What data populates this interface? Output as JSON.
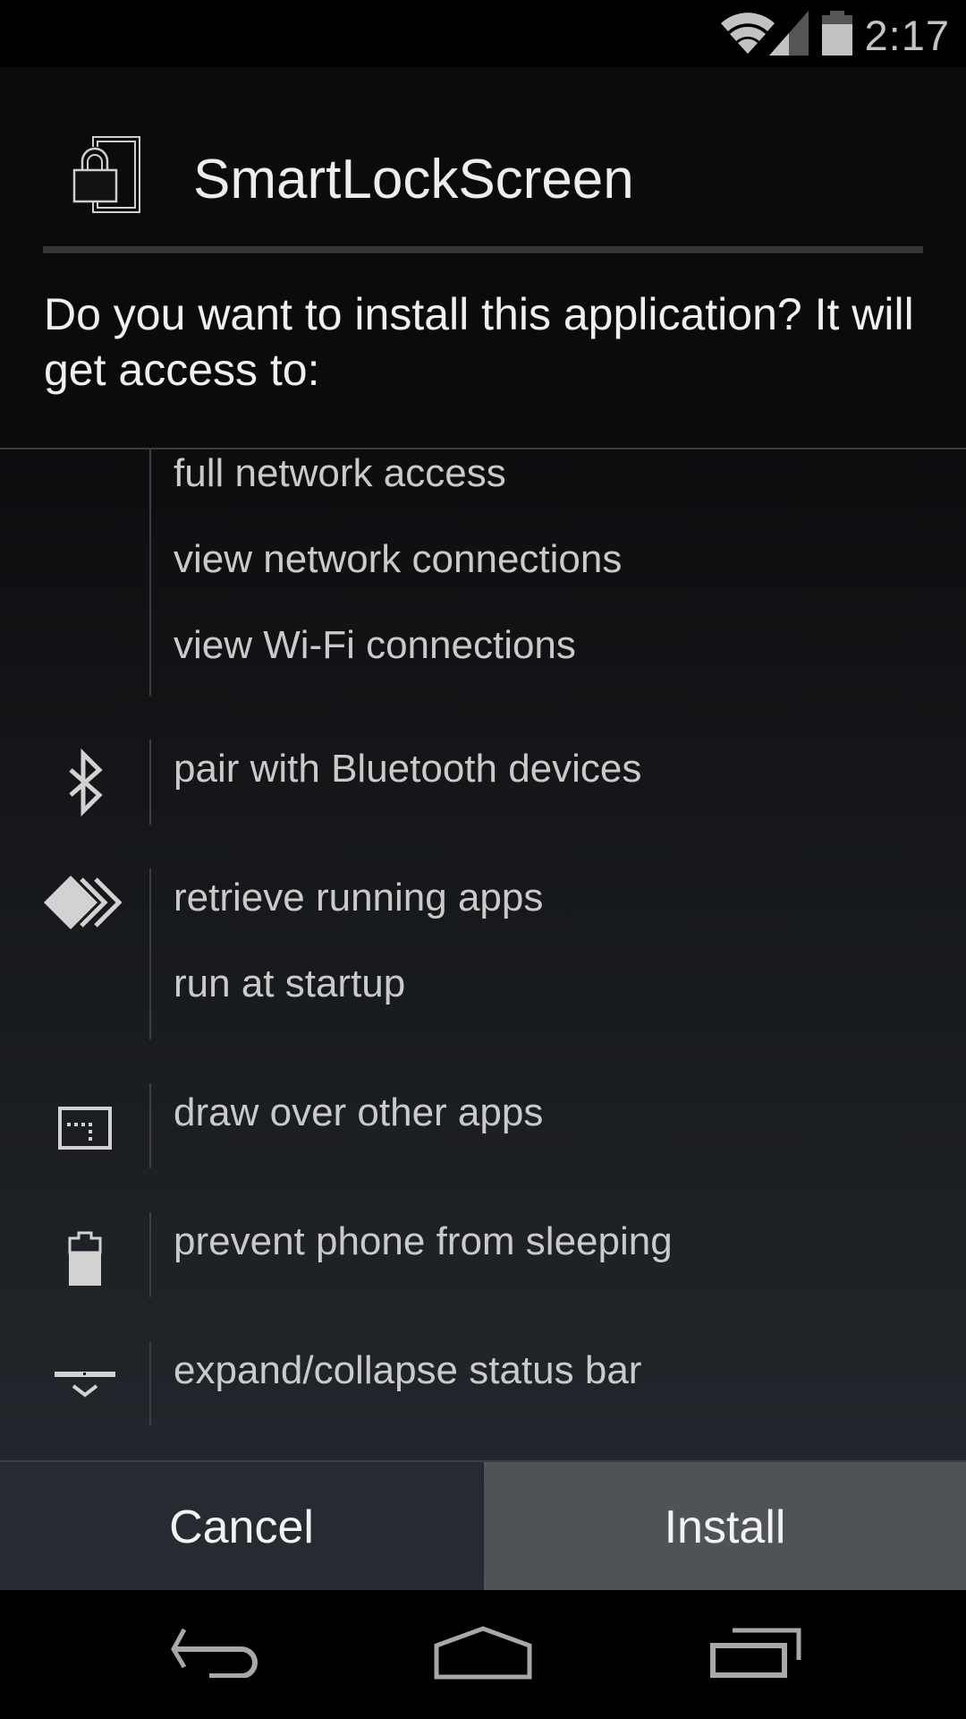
{
  "status_bar": {
    "time": "2:17",
    "icons": [
      "wifi-icon",
      "cell-signal-icon",
      "battery-icon"
    ]
  },
  "dialog": {
    "app_name": "SmartLockScreen",
    "app_icon": "lock-screen-app-icon",
    "question": "Do you want to install this application? It will get access to:",
    "permission_groups": [
      {
        "icon": "network-icon",
        "permissions": [
          "full network access",
          "view network connections",
          "view Wi-Fi connections"
        ]
      },
      {
        "icon": "bluetooth-icon",
        "permissions": [
          "pair with Bluetooth devices"
        ]
      },
      {
        "icon": "running-apps-icon",
        "permissions": [
          "retrieve running apps",
          "run at startup"
        ]
      },
      {
        "icon": "draw-over-apps-icon",
        "permissions": [
          "draw over other apps"
        ]
      },
      {
        "icon": "battery-icon",
        "permissions": [
          "prevent phone from sleeping"
        ]
      },
      {
        "icon": "status-bar-icon",
        "permissions": [
          "expand/collapse status bar"
        ]
      }
    ],
    "buttons": {
      "cancel": "Cancel",
      "install": "Install"
    }
  },
  "nav_bar": {
    "buttons": [
      "back-icon",
      "home-icon",
      "recents-icon"
    ]
  }
}
